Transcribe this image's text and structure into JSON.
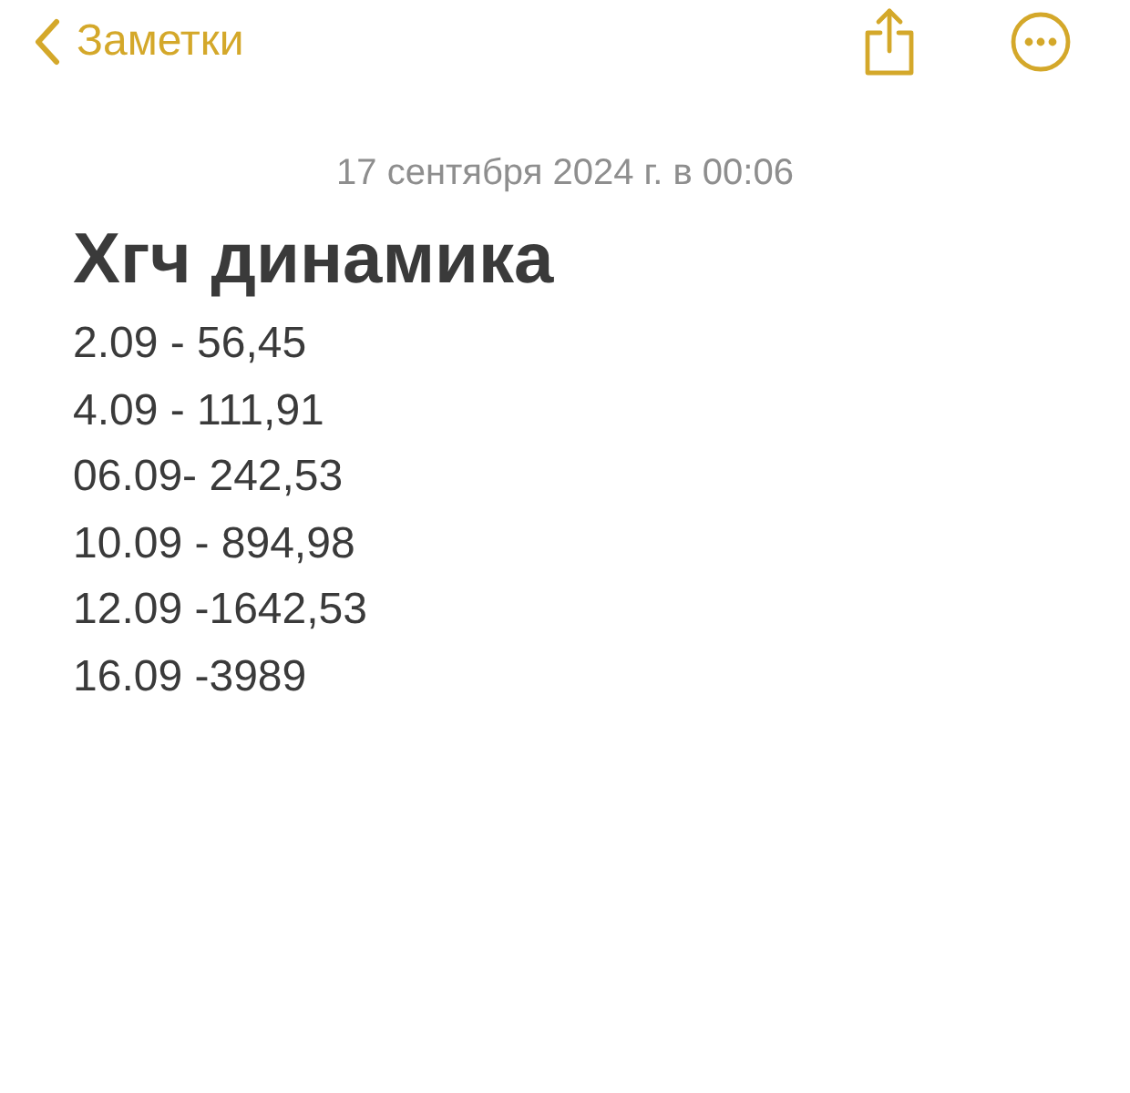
{
  "nav": {
    "back_label": "Заметки"
  },
  "note": {
    "timestamp": "17 сентября 2024 г. в 00:06",
    "title": "Хгч динамика",
    "lines": [
      "2.09 - 56,45",
      "4.09 - 111,91",
      "06.09- 242,53",
      "10.09 - 894,98",
      "12.09 -1642,53",
      "16.09 -3989"
    ]
  }
}
